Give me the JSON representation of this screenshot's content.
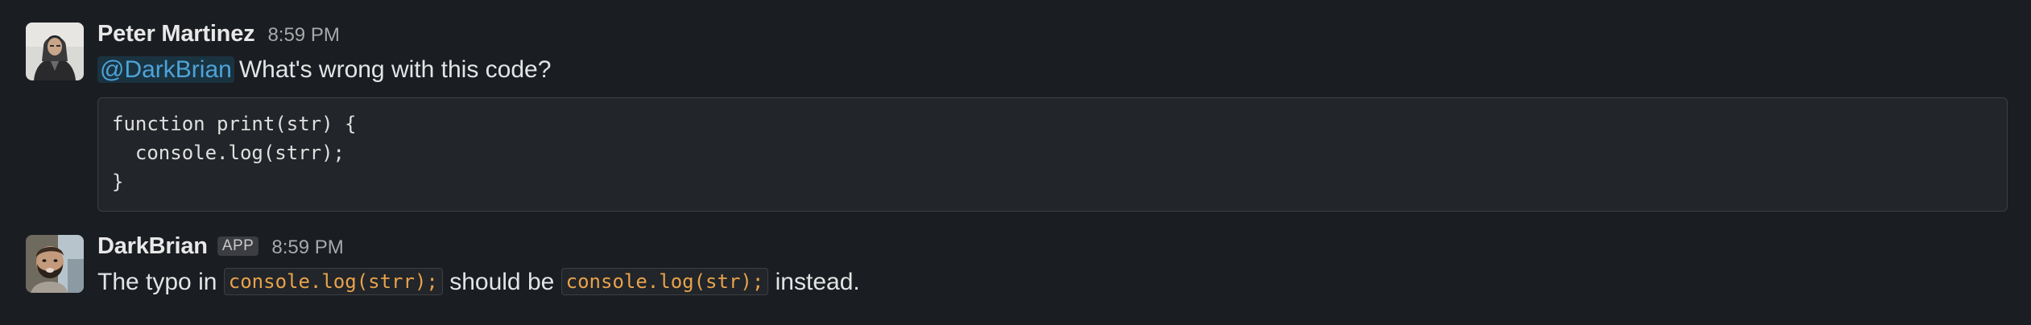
{
  "messages": [
    {
      "author": "Peter Martinez",
      "time": "8:59 PM",
      "mention": "@DarkBrian",
      "text": "What's wrong with this code?",
      "code": "function print(str) {\n  console.log(strr);\n}"
    },
    {
      "author": "DarkBrian",
      "badge": "APP",
      "time": "8:59 PM",
      "text_parts": [
        "The typo in",
        "console.log(strr);",
        "should be",
        "console.log(str);",
        "instead."
      ]
    }
  ],
  "colors": {
    "background": "#1a1d21",
    "mention": "#4ea3d8",
    "inline_code": "#e8a24c",
    "code_bg": "#222529"
  },
  "icons": {
    "avatar1": "avatar-peter-martinez",
    "avatar2": "avatar-darkbrian"
  }
}
